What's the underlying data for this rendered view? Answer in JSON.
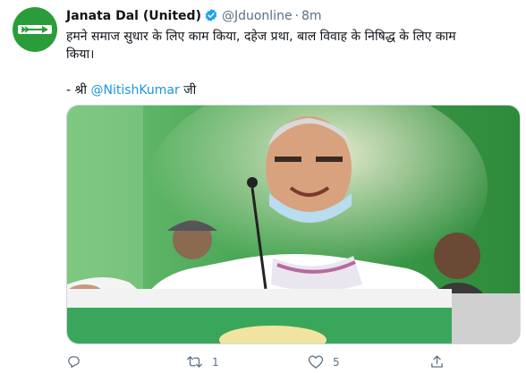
{
  "tweet": {
    "name": "Janata Dal (United)",
    "handle": "@Jduonline",
    "separator": "·",
    "time": "8m",
    "text_line1": "हमने समाज सुधार के लिए काम किया, दहेज प्रथा, बाल विवाह के निषिद्ध के लिए काम",
    "text_line2": "किया।",
    "attribution_prefix": "- श्री ",
    "attribution_mention": "@NitishKumar",
    "attribution_suffix": " जी"
  },
  "actions": {
    "reply_count": "",
    "retweet_count": "1",
    "like_count": "5"
  },
  "colors": {
    "brand_green": "#2a9d3a",
    "link_blue": "#1b95e0",
    "verified_blue": "#1da1f2",
    "muted_gray": "#5b7083"
  },
  "icons": [
    "jdu-arrow-logo",
    "verified-badge-icon",
    "reply-icon",
    "retweet-icon",
    "like-icon",
    "share-icon"
  ]
}
